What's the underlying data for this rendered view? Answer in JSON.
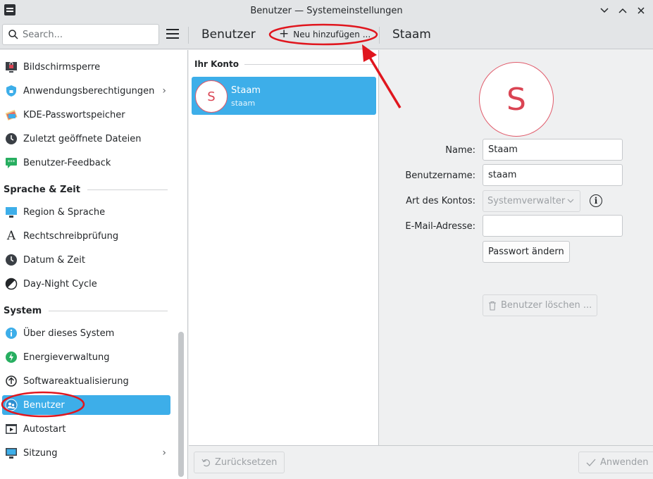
{
  "window": {
    "title": "Benutzer — Systemeinstellungen"
  },
  "search": {
    "placeholder": "Search..."
  },
  "header": {
    "page_title": "Benutzer",
    "add_label": "Neu hinzufügen ...",
    "selected_user": "Staam"
  },
  "sidebar": {
    "items_top": [
      {
        "label": "Bildschirmsperre",
        "icon": "lock-screen-icon"
      },
      {
        "label": "Anwendungsberechtigungen",
        "icon": "shield-icon",
        "chevron": true
      },
      {
        "label": "KDE-Passwortspeicher",
        "icon": "wallet-icon"
      },
      {
        "label": "Zuletzt geöffnete Dateien",
        "icon": "clock-icon"
      },
      {
        "label": "Benutzer-Feedback",
        "icon": "feedback-icon"
      }
    ],
    "section_language": "Sprache & Zeit",
    "items_language": [
      {
        "label": "Region & Sprache",
        "icon": "region-icon"
      },
      {
        "label": "Rechtschreibprüfung",
        "icon": "spellcheck-icon"
      },
      {
        "label": "Datum & Zeit",
        "icon": "clock-icon"
      },
      {
        "label": "Day-Night Cycle",
        "icon": "day-night-icon"
      }
    ],
    "section_system": "System",
    "items_system": [
      {
        "label": "Über dieses System",
        "icon": "info-icon"
      },
      {
        "label": "Energieverwaltung",
        "icon": "power-icon"
      },
      {
        "label": "Softwareaktualisierung",
        "icon": "update-icon"
      },
      {
        "label": "Benutzer",
        "icon": "users-icon",
        "active": true
      },
      {
        "label": "Autostart",
        "icon": "autostart-icon"
      },
      {
        "label": "Sitzung",
        "icon": "session-icon",
        "chevron": true
      }
    ]
  },
  "middle": {
    "section": "Ihr Konto",
    "user": {
      "initial": "S",
      "name": "Staam",
      "login": "staam"
    }
  },
  "detail": {
    "avatar_initial": "S",
    "name_label": "Name:",
    "name_value": "Staam",
    "username_label": "Benutzername:",
    "username_value": "staam",
    "account_type_label": "Art des Kontos:",
    "account_type_value": "Systemverwalter",
    "email_label": "E-Mail-Adresse:",
    "email_value": "",
    "password_button": "Passwort ändern",
    "delete_button": "Benutzer löschen ..."
  },
  "footer": {
    "reset_label": "Zurücksetzen",
    "apply_label": "Anwenden"
  },
  "colors": {
    "accent": "#3daee9",
    "avatar": "#da4453",
    "annotation": "#e0161e"
  }
}
